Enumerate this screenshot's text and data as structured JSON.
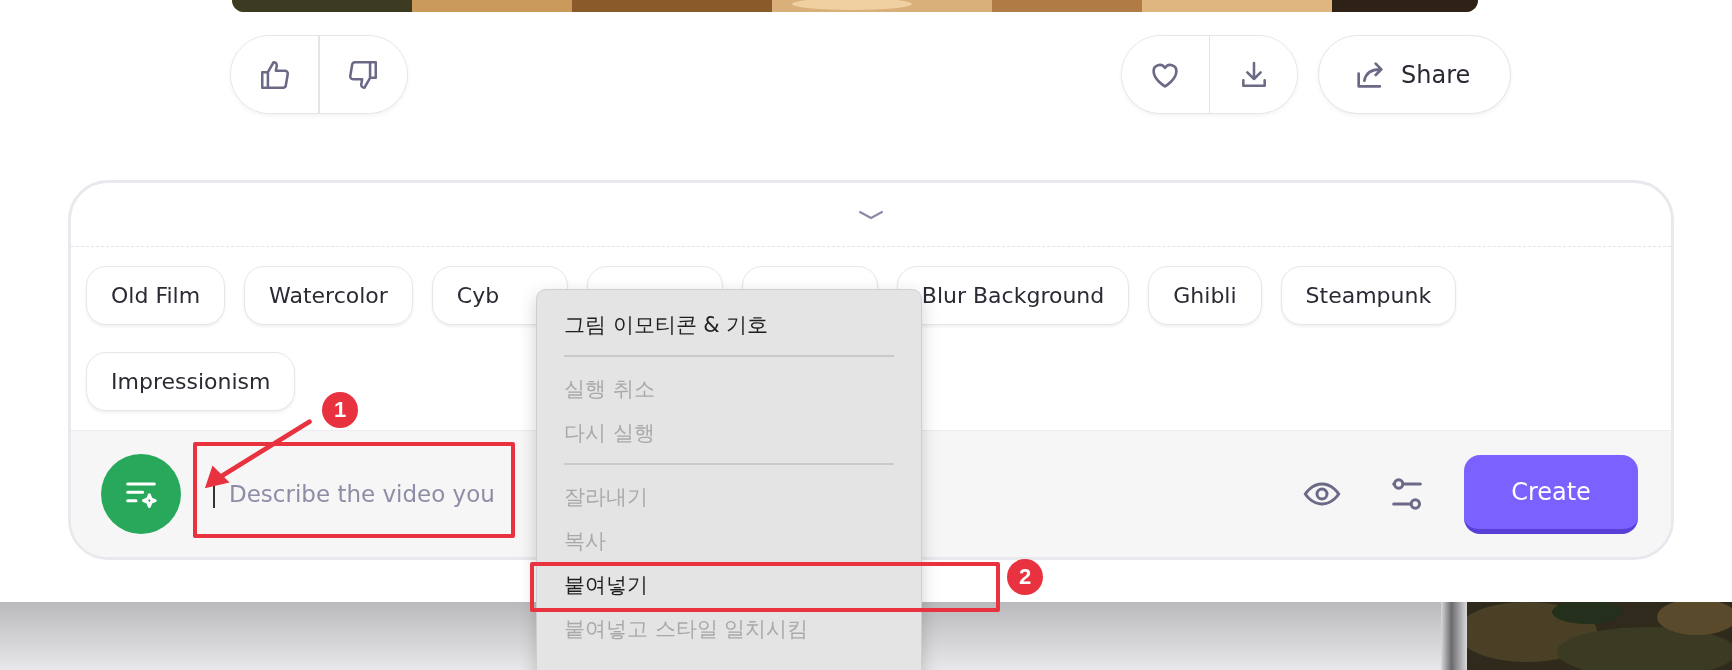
{
  "feedback": {
    "like_selected": false,
    "dislike_selected": false
  },
  "actions": {
    "share_label": "Share"
  },
  "composer": {
    "expanded": true,
    "chips": [
      {
        "label": "Old Film",
        "covered": false
      },
      {
        "label": "Watercolor",
        "covered": false
      },
      {
        "label": "Cyb",
        "covered": true
      },
      {
        "covered": true
      },
      {
        "covered": true
      },
      {
        "label": "Blur Background",
        "covered": false
      },
      {
        "label": "Ghibli",
        "covered": false
      },
      {
        "label": "Steampunk",
        "covered": false
      },
      {
        "label": "Impressionism",
        "covered": false
      }
    ],
    "placeholder": "Describe the video you",
    "create_label": "Create"
  },
  "menu": {
    "items": [
      {
        "kind": "item",
        "label": "그림 이모티콘 & 기호",
        "disabled": false
      },
      {
        "kind": "separator"
      },
      {
        "kind": "item",
        "label": "실행 취소",
        "disabled": true
      },
      {
        "kind": "item",
        "label": "다시 실행",
        "disabled": true
      },
      {
        "kind": "separator"
      },
      {
        "kind": "item",
        "label": "잘라내기",
        "disabled": true
      },
      {
        "kind": "item",
        "label": "복사",
        "disabled": true
      },
      {
        "kind": "item",
        "label": "붙여넣기",
        "disabled": false
      },
      {
        "kind": "item",
        "label": "붙여넣고 스타일 일치시킴",
        "disabled": true
      }
    ]
  },
  "annotations": [
    {
      "number": "1"
    },
    {
      "number": "2"
    }
  ]
}
